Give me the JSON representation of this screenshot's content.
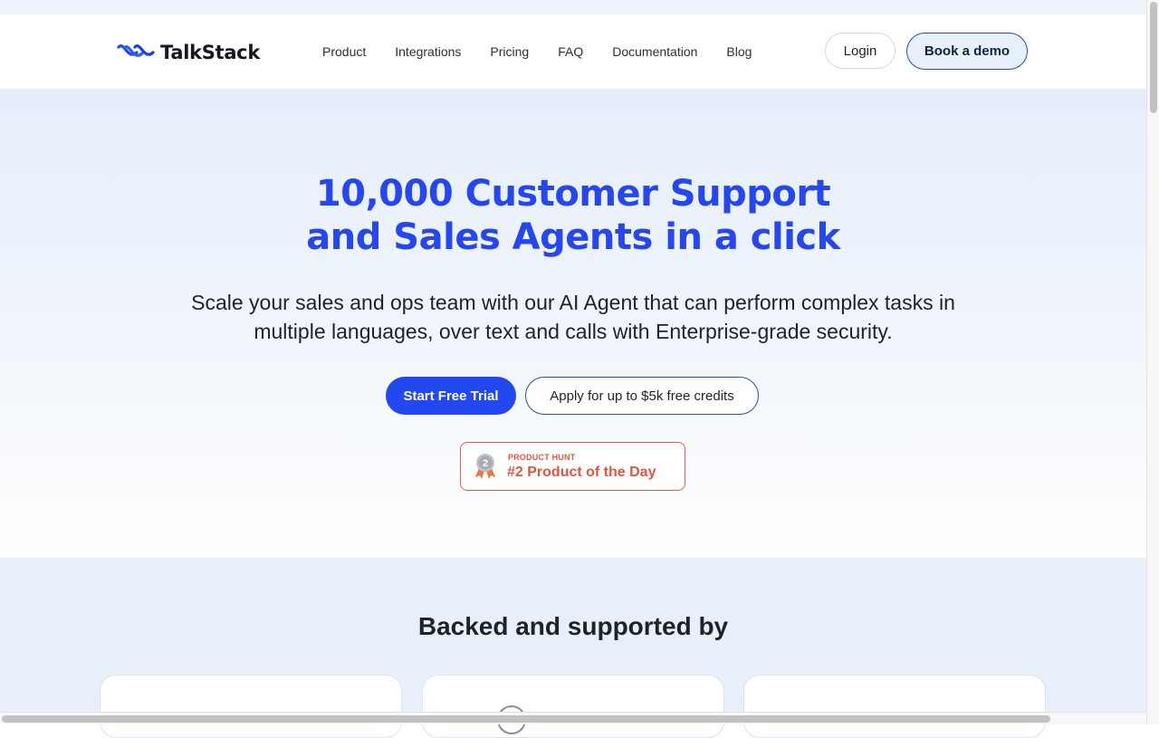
{
  "brand": {
    "name": "TalkStack",
    "accent": "#2546f0"
  },
  "nav": {
    "links": [
      "Product",
      "Integrations",
      "Pricing",
      "FAQ",
      "Documentation",
      "Blog"
    ],
    "login_label": "Login",
    "demo_label": "Book a demo"
  },
  "hero": {
    "title_line1": "10,000 Customer Support",
    "title_line2": "and Sales Agents in a click",
    "subtitle_line1": "Scale your sales and ops team with our AI Agent that can perform complex tasks in",
    "subtitle_line2": "multiple languages, over text and calls with Enterprise-grade security.",
    "cta_primary": "Start Free Trial",
    "cta_secondary": "Apply for up to $5k free credits"
  },
  "product_hunt": {
    "kicker": "PRODUCT HUNT",
    "title": "#2 Product of the Day",
    "rank": "2",
    "color": "#e4553f"
  },
  "backed": {
    "title": "Backed and supported by"
  },
  "icons": {
    "logo": "wave-logo-icon",
    "medal": "medal-icon"
  }
}
